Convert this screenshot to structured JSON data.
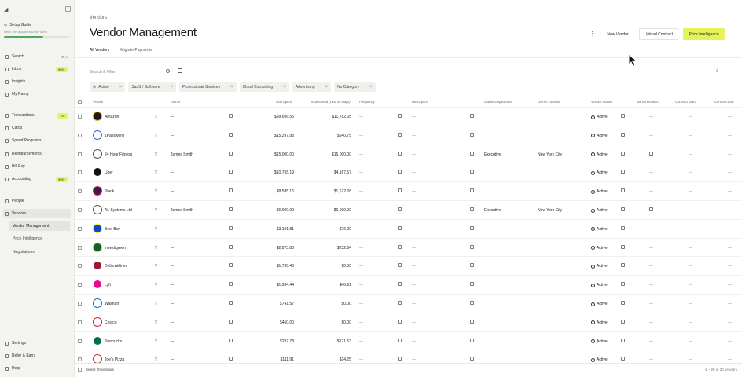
{
  "sidebar": {
    "setup": {
      "title": "Setup Guide",
      "subtitle": "Next: Get a quick tour of Ramp",
      "progress": 0.6
    },
    "items": [
      {
        "label": "Search",
        "kbd": "⌘ K",
        "icon": "search-icon"
      },
      {
        "label": "Inbox",
        "badge": "999+",
        "icon": "inbox-icon"
      },
      {
        "label": "Insights",
        "icon": "insights-icon"
      },
      {
        "label": "My Ramp",
        "icon": "home-icon"
      },
      {
        "label": "Transactions",
        "badge": "107",
        "icon": "transactions-icon"
      },
      {
        "label": "Cards",
        "icon": "card-icon"
      },
      {
        "label": "Spend Programs",
        "icon": "program-icon"
      },
      {
        "label": "Reimbursements",
        "icon": "reimburse-icon"
      },
      {
        "label": "Bill Pay",
        "icon": "bill-icon"
      },
      {
        "label": "Accounting",
        "badge": "999+",
        "icon": "accounting-icon"
      },
      {
        "label": "People",
        "icon": "people-icon"
      },
      {
        "label": "Vendors",
        "icon": "vendors-icon"
      }
    ],
    "sub": [
      "Vendor Management",
      "Price Intelligence",
      "Negotiations"
    ],
    "bottom": [
      "Settings",
      "Refer & Earn",
      "Help"
    ]
  },
  "header": {
    "breadcrumb": "Vendors",
    "title": "Vendor Management",
    "more": "⋮",
    "new_vendor": "New Vendor",
    "upload_contract": "Upload Contract",
    "price_intelligence": "Price Intelligence"
  },
  "tabs": [
    "All Vendors",
    "Migrate Payments"
  ],
  "search": {
    "placeholder": "Search & Filter"
  },
  "chips": [
    "Active",
    "SaaS / Software",
    "Professional Services",
    "Cloud Computing",
    "Advertising",
    "No Category"
  ],
  "columns": [
    "Vendor",
    "Owner",
    "Total Spend",
    "Total Spend (Last 30 Days)",
    "Frequency",
    "Description",
    "Owner Department",
    "Owner Location",
    "Vendor Status",
    "Tax Information",
    "Contract Start",
    "Contract End"
  ],
  "rows": [
    {
      "name": "Amazon",
      "owner": "—",
      "spend": "$99,696.55",
      "spend30": "$11,782.05",
      "freq": "—",
      "desc": "—",
      "dept": "",
      "loc": "",
      "status": "Active",
      "logo": "#1a1a1a",
      "accent": "#f29b1d"
    },
    {
      "name": "1Password",
      "owner": "—",
      "spend": "$15,297.98",
      "spend30": "$540.75",
      "freq": "—",
      "desc": "—",
      "dept": "",
      "loc": "",
      "status": "Active",
      "logo": "#ffffff",
      "accent": "#2a6ad8"
    },
    {
      "name": "24 Hour Fitness",
      "owner": "James Smith",
      "spend": "$15,000.00",
      "spend30": "$15,000.00",
      "freq": "—",
      "desc": "—",
      "dept": "Executive",
      "loc": "New York City",
      "status": "Active",
      "logo": "#ffffff",
      "accent": "#555555"
    },
    {
      "name": "Uber",
      "owner": "—",
      "spend": "$10,765.19",
      "spend30": "$4,167.57",
      "freq": "—",
      "desc": "—",
      "dept": "",
      "loc": "",
      "status": "Active",
      "logo": "#111111",
      "accent": "#ffffff"
    },
    {
      "name": "Slack",
      "owner": "—",
      "spend": "$8,585.16",
      "spend30": "$1,672.28",
      "freq": "—",
      "desc": "—",
      "dept": "",
      "loc": "",
      "status": "Active",
      "logo": "#3f1a45",
      "accent": "#e01e5a"
    },
    {
      "name": "AL Systems Ltd",
      "owner": "James Smith",
      "spend": "$6,000.00",
      "spend30": "$6,000.00",
      "freq": "—",
      "desc": "—",
      "dept": "Executive",
      "loc": "New York City",
      "status": "Active",
      "logo": "#ffffff",
      "accent": "#555555"
    },
    {
      "name": "Best Buy",
      "owner": "—",
      "spend": "$3,191.81",
      "spend30": "$76.20",
      "freq": "—",
      "desc": "—",
      "dept": "",
      "loc": "",
      "status": "Active",
      "logo": "#0a4abf",
      "accent": "#ffe000"
    },
    {
      "name": "investigreen",
      "owner": "—",
      "spend": "$2,873.83",
      "spend30": "$232.84",
      "freq": "—",
      "desc": "—",
      "dept": "",
      "loc": "",
      "status": "Active",
      "logo": "#1d5a2c",
      "accent": "#9ed36a"
    },
    {
      "name": "Delta Airlines",
      "owner": "—",
      "spend": "$1,730.40",
      "spend30": "$0.00",
      "freq": "—",
      "desc": "—",
      "dept": "",
      "loc": "",
      "status": "Active",
      "logo": "#9b1b30",
      "accent": "#ffffff"
    },
    {
      "name": "Lyft",
      "owner": "—",
      "spend": "$1,934.44",
      "spend30": "$40.91",
      "freq": "—",
      "desc": "—",
      "dept": "",
      "loc": "",
      "status": "Active",
      "logo": "#ea0b8c",
      "accent": "#ffffff"
    },
    {
      "name": "Walmart",
      "owner": "—",
      "spend": "$741.57",
      "spend30": "$0.00",
      "freq": "—",
      "desc": "—",
      "dept": "",
      "loc": "",
      "status": "Active",
      "logo": "#ffffff",
      "accent": "#0071ce"
    },
    {
      "name": "Costco",
      "owner": "—",
      "spend": "$450.00",
      "spend30": "$0.00",
      "freq": "—",
      "desc": "—",
      "dept": "",
      "loc": "",
      "status": "Active",
      "logo": "#ffffff",
      "accent": "#e31837"
    },
    {
      "name": "Starbucks",
      "owner": "—",
      "spend": "$237.78",
      "spend30": "$121.63",
      "freq": "—",
      "desc": "—",
      "dept": "",
      "loc": "",
      "status": "Active",
      "logo": "#00704a",
      "accent": "#ffffff"
    },
    {
      "name": "Joe's Pizza",
      "owner": "—",
      "spend": "$111.91",
      "spend30": "$14.25",
      "freq": "—",
      "desc": "—",
      "dept": "",
      "loc": "",
      "status": "Active",
      "logo": "#ffffff",
      "accent": "#c0392b"
    }
  ],
  "footer": {
    "select": "Select 20 vendors",
    "page": "1 – 20 of 20 vendors"
  }
}
